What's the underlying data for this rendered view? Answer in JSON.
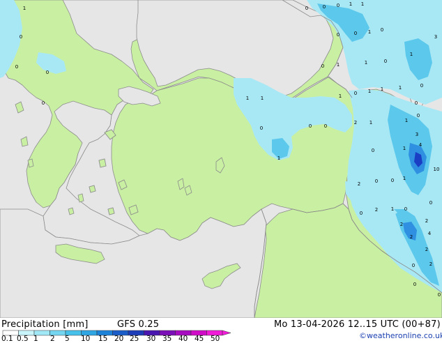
{
  "title_left": "Precipitation [mm]",
  "model": "GFS 0.25",
  "valid_time": "Mo 13-04-2026 12..15 UTC (00+87)",
  "credit": "©weatheronline.co.uk",
  "colors": {
    "sea": "#e6e6e6",
    "land": "#c9f0a2",
    "coast": "#8c8c8c",
    "rain_light": "#a8e8f5",
    "rain_mid": "#5cc8ec",
    "rain_heavy": "#2f8fe0",
    "rain_max": "#1a3fc4"
  },
  "legend": {
    "ticks": [
      "0.1",
      "0.5",
      "1",
      "2",
      "5",
      "10",
      "15",
      "20",
      "25",
      "30",
      "35",
      "40",
      "45",
      "50"
    ],
    "colors": [
      "#ffffff",
      "#c8f4fb",
      "#a0e8f6",
      "#74d6f0",
      "#46c1ea",
      "#2ea6e4",
      "#1c82d8",
      "#1a5cc8",
      "#1c3cb8",
      "#4a16b0",
      "#7c10b8",
      "#a80cc0",
      "#d00cc8",
      "#f01cd8"
    ]
  },
  "map_labels": [
    {
      "t": "1"
    },
    {
      "t": "0"
    },
    {
      "t": "0"
    },
    {
      "t": "0"
    },
    {
      "t": "0"
    },
    {
      "t": "0"
    },
    {
      "t": "0"
    },
    {
      "t": "0"
    },
    {
      "t": "1"
    },
    {
      "t": "1"
    },
    {
      "t": "0"
    },
    {
      "t": "1"
    },
    {
      "t": "0"
    },
    {
      "t": "0"
    },
    {
      "t": "1"
    },
    {
      "t": "3"
    },
    {
      "t": "0"
    },
    {
      "t": "1"
    },
    {
      "t": "0"
    },
    {
      "t": "1"
    },
    {
      "t": "1"
    },
    {
      "t": "0"
    },
    {
      "t": "1"
    },
    {
      "t": "1"
    },
    {
      "t": "1"
    },
    {
      "t": "0"
    },
    {
      "t": "1"
    },
    {
      "t": "1"
    },
    {
      "t": "0"
    },
    {
      "t": "0"
    },
    {
      "t": "0"
    },
    {
      "t": "2"
    },
    {
      "t": "1"
    },
    {
      "t": "0"
    },
    {
      "t": "0"
    },
    {
      "t": "1"
    },
    {
      "t": "3"
    },
    {
      "t": "0"
    },
    {
      "t": "0"
    },
    {
      "t": "1"
    },
    {
      "t": "4"
    },
    {
      "t": "10"
    },
    {
      "t": "0"
    },
    {
      "t": "1"
    },
    {
      "t": "2"
    },
    {
      "t": "0"
    },
    {
      "t": "2"
    },
    {
      "t": "1"
    },
    {
      "t": "0"
    },
    {
      "t": "0"
    },
    {
      "t": "2"
    },
    {
      "t": "2"
    },
    {
      "t": "1"
    },
    {
      "t": "0"
    },
    {
      "t": "2"
    },
    {
      "t": "4"
    },
    {
      "t": "2"
    },
    {
      "t": "0"
    },
    {
      "t": "2"
    },
    {
      "t": "0"
    }
  ]
}
